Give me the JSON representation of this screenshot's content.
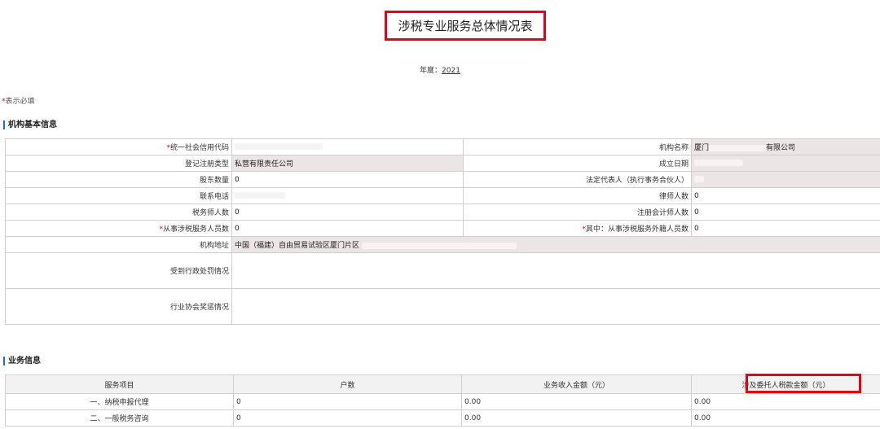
{
  "page": {
    "title": "涉税专业服务总体情况表",
    "year_label": "年度：",
    "year_value": "2021",
    "required_star": "*",
    "required_note": "表示必填"
  },
  "sections": {
    "basic": "机构基本信息",
    "business": "业务信息"
  },
  "basic_info": {
    "credit_code_label": "统一社会信用代码",
    "org_name_label": "机构名称",
    "org_name_prefix": "厦门",
    "org_name_suffix": "有限公司",
    "reg_type_label": "登记注册类型",
    "reg_type_value": "私营有限责任公司",
    "found_date_label": "成立日期",
    "shareholders_label": "股东数量",
    "shareholders_value": "0",
    "legal_rep_label": "法定代表人（执行事务合伙人）",
    "phone_label": "联系电话",
    "lawyers_label": "律师人数",
    "lawyers_value": "0",
    "tax_agents_label": "税务师人数",
    "tax_agents_value": "0",
    "accountants_label": "注册会计师人数",
    "accountants_value": "0",
    "staff_label": "从事涉税服务人员数",
    "staff_value": "0",
    "foreign_staff_label": "其中：从事涉税服务外籍人员数",
    "foreign_staff_value": "0",
    "address_label": "机构地址",
    "address_value": "中国（福建）自由贸易试验区厦门片区",
    "penalty_label": "受到行政处罚情况",
    "award_label": "行业协会奖惩情况"
  },
  "business_table": {
    "headers": [
      "服务项目",
      "户数",
      "业务收入金额（元）",
      "涉及委托人税款金额（元）"
    ],
    "rows": [
      {
        "item": "一、纳税申报代理",
        "count": "0",
        "income": "0.00",
        "tax": "0.00"
      },
      {
        "item": "二、一般税务咨询",
        "count": "0",
        "income": "0.00",
        "tax": "0.00"
      }
    ]
  },
  "colors": {
    "highlight": "#e60012",
    "accent": "#1a73c8",
    "value_cell_bg": "#ece5e5"
  }
}
